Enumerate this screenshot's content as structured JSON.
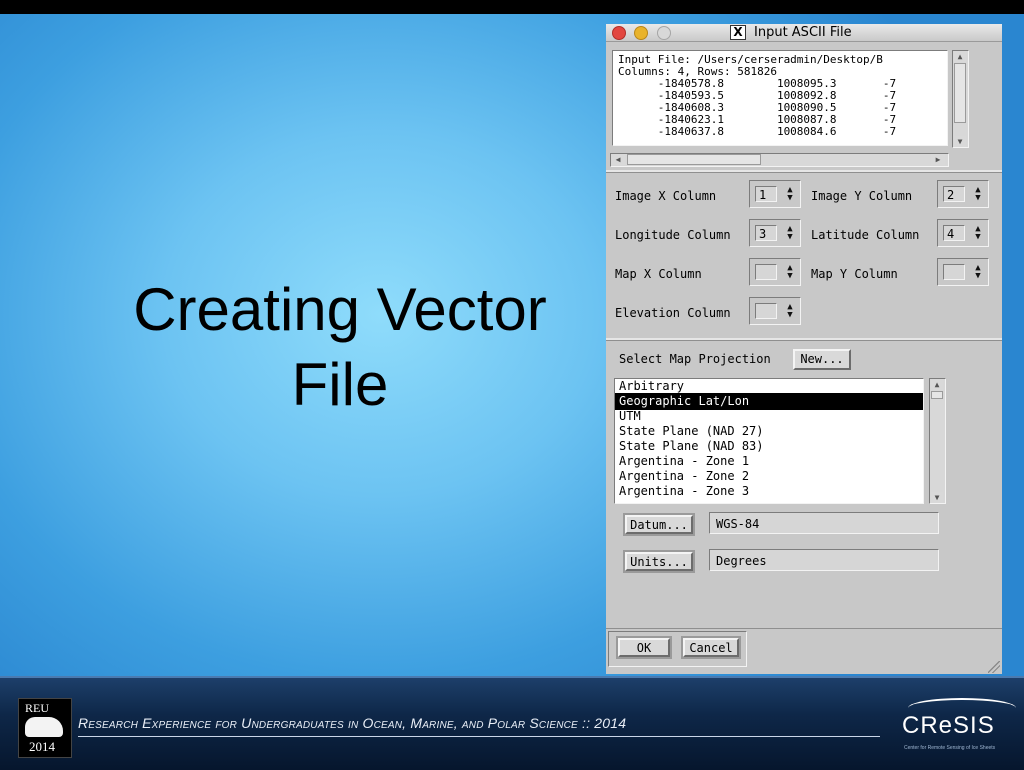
{
  "slide": {
    "title": "Creating Vector\nFile"
  },
  "window": {
    "title": "Input ASCII File",
    "x11_icon": "X",
    "preview_text": "Input File: /Users/cerseradmin/Desktop/B\nColumns: 4, Rows: 581826\n      -1840578.8        1008095.3       -7\n      -1840593.5        1008092.8       -7\n      -1840608.3        1008090.5       -7\n      -1840623.1        1008087.8       -7\n      -1840637.8        1008084.6       -7",
    "columns": {
      "image_x": {
        "label": "Image X Column",
        "value": "1"
      },
      "image_y": {
        "label": "Image Y Column",
        "value": "2"
      },
      "longitude": {
        "label": "Longitude Column",
        "value": "3"
      },
      "latitude": {
        "label": "Latitude Column",
        "value": "4"
      },
      "map_x": {
        "label": "Map X Column",
        "value": ""
      },
      "map_y": {
        "label": "Map Y Column",
        "value": ""
      },
      "elevation": {
        "label": "Elevation Column",
        "value": ""
      }
    },
    "projection": {
      "label": "Select Map Projection",
      "new_button": "New...",
      "items": [
        "Arbitrary",
        "Geographic Lat/Lon",
        "UTM",
        "State Plane (NAD 27)",
        "State Plane (NAD 83)",
        "Argentina - Zone 1",
        "Argentina - Zone 2",
        "Argentina - Zone 3"
      ],
      "selected": "Geographic Lat/Lon"
    },
    "datum": {
      "button": "Datum...",
      "value": "WGS-84"
    },
    "units": {
      "button": "Units...",
      "value": "Degrees"
    },
    "ok_button": "OK",
    "cancel_button": "Cancel",
    "colors": {
      "selection_bg": "#000000",
      "selection_fg": "#ffffff",
      "window_bg": "#c8c8c8"
    }
  },
  "footer": {
    "logo_top": "REU",
    "logo_year": "2014",
    "text": "Research Experience for Undergraduates in Ocean, Marine, and Polar Science :: 2014",
    "brand": "CReSIS",
    "brand_sub": "Center for Remote Sensing of Ice Sheets"
  }
}
